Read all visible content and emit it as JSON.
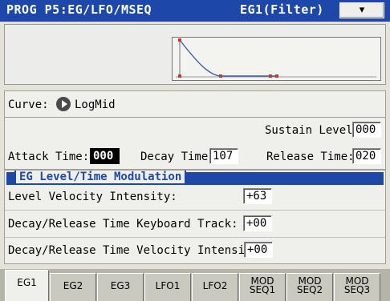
{
  "header": {
    "page_title": "PROG P5:EG/LFO/MSEQ",
    "edit_target": "EG1(Filter)",
    "menu_icon": "chevron-down-icon"
  },
  "envelope": {
    "curve_label": "Curve:",
    "curve_value": "LogMid"
  },
  "params": {
    "sustain_label": "Sustain Level:",
    "sustain_value": "000",
    "attack_label": "Attack Time:",
    "attack_value": "000",
    "decay_label": "Decay Time:",
    "decay_value": "107",
    "release_label": "Release Time:",
    "release_value": "020"
  },
  "modulation": {
    "title": "EG Level/Time Modulation",
    "level_vel_label": "Level Velocity Intensity:",
    "level_vel_value": "+63",
    "dr_kbd_label": "Decay/Release Time Keyboard Track:",
    "dr_kbd_value": "+00",
    "dr_vel_label": "Decay/Release Time Velocity Intensity:",
    "dr_vel_value": "+00"
  },
  "tabs": [
    {
      "line1": "EG1",
      "line2": ""
    },
    {
      "line1": "EG2",
      "line2": ""
    },
    {
      "line1": "EG3",
      "line2": ""
    },
    {
      "line1": "LFO1",
      "line2": ""
    },
    {
      "line1": "LFO2",
      "line2": ""
    },
    {
      "line1": "MOD",
      "line2": "SEQ1"
    },
    {
      "line1": "MOD",
      "line2": "SEQ2"
    },
    {
      "line1": "MOD",
      "line2": "SEQ3"
    }
  ],
  "colors": {
    "accent": "#1d47a8",
    "envelope_line": "#3b5fb0",
    "envelope_point": "#c0392b"
  }
}
